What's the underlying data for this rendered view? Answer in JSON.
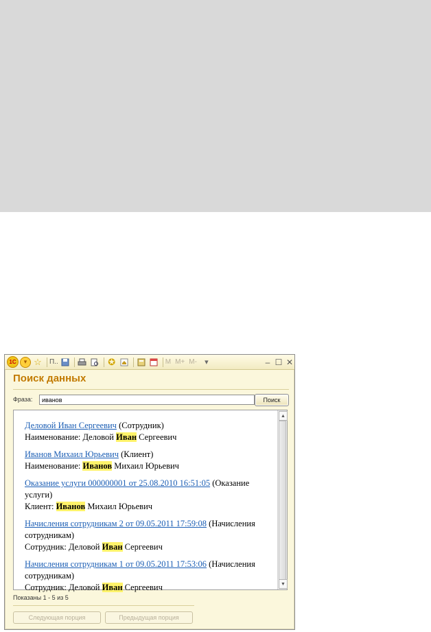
{
  "toolbar": {
    "logo": "1С",
    "menu_label": "П..",
    "m_labels": [
      "M",
      "M+",
      "M-"
    ]
  },
  "window": {
    "title": "Поиск данных"
  },
  "search": {
    "label": "Фраза:",
    "value": "иванов",
    "button": "Поиск"
  },
  "results": [
    {
      "link": "Деловой Иван Сергеевич",
      "type": "(Сотрудник)",
      "detail_label": "Наименование:",
      "pre": "Деловой",
      "match": "Иван",
      "post": "Сергеевич"
    },
    {
      "link": "Иванов Михаил Юрьевич",
      "type": "(Клиент)",
      "detail_label": "Наименование:",
      "pre": "",
      "match": "Иванов",
      "post": "Михаил Юрьевич"
    },
    {
      "link": "Оказание услуги 000000001 от 25.08.2010 16:51:05",
      "type": "(Оказание услуги)",
      "detail_label": "Клиент:",
      "pre": "",
      "match": "Иванов",
      "post": "Михаил Юрьевич"
    },
    {
      "link": "Начисления сотрудникам 2 от 09.05.2011 17:59:08",
      "type": "(Начисления сотрудникам)",
      "detail_label": "Сотрудник:",
      "pre": "Деловой",
      "match": "Иван",
      "post": "Сергеевич"
    },
    {
      "link": "Начисления сотрудникам 1 от 09.05.2011 17:53:06",
      "type": "(Начисления сотрудникам)",
      "detail_label": "Сотрудник:",
      "pre": "Деловой",
      "match": "Иван",
      "post": "Сергеевич"
    }
  ],
  "footer": {
    "shown": "Показаны 1 - 5 из 5",
    "next_button": "Следующая порция",
    "prev_button": "Предыдущая порция"
  }
}
